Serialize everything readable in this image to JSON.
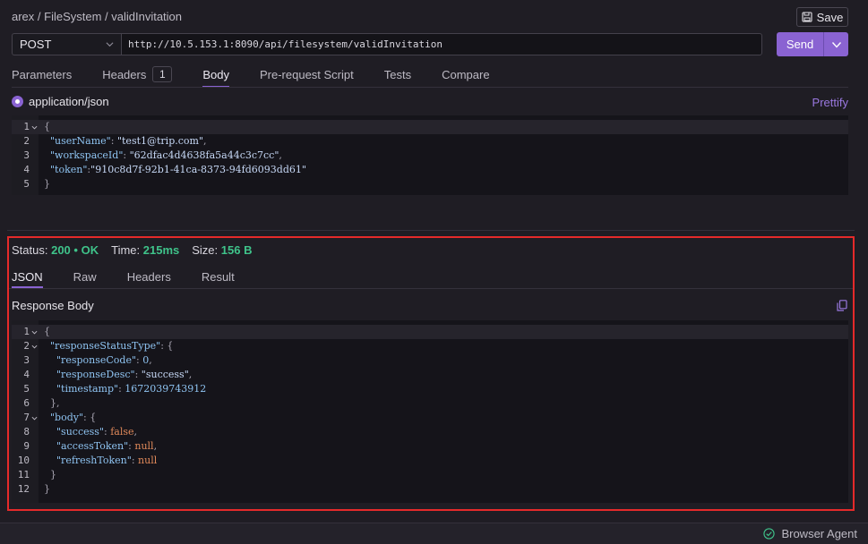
{
  "breadcrumb": "arex / FileSystem / validInvitation",
  "toolbar": {
    "save_label": "Save"
  },
  "request": {
    "method": "POST",
    "url": "http://10.5.153.1:8090/api/filesystem/validInvitation",
    "send_label": "Send"
  },
  "tabs": {
    "parameters": "Parameters",
    "headers": "Headers",
    "headers_count": "1",
    "body": "Body",
    "prerequest": "Pre-request Script",
    "tests": "Tests",
    "compare": "Compare"
  },
  "body": {
    "content_type": "application/json",
    "prettify_label": "Prettify",
    "line_numbers": [
      "1",
      "2",
      "3",
      "4",
      "5"
    ],
    "lines": {
      "l1": "{",
      "l2_key": "\"userName\"",
      "l2_val": "\"test1@trip.com\"",
      "l3_key": "\"workspaceId\"",
      "l3_val": "\"62dfac4d4638fa5a44c3c7cc\"",
      "l4_key": "\"token\"",
      "l4_val": "\"910c8d7f-92b1-41ca-8373-94fd6093dd61\"",
      "l5": "}"
    }
  },
  "response": {
    "status_label": "Status:",
    "status_code": "200",
    "status_dot": "•",
    "status_text": "OK",
    "time_label": "Time:",
    "time_value": "215ms",
    "size_label": "Size:",
    "size_value": "156 B",
    "tabs": {
      "json": "JSON",
      "raw": "Raw",
      "headers": "Headers",
      "result": "Result"
    },
    "title": "Response Body",
    "line_numbers": [
      "1",
      "2",
      "3",
      "4",
      "5",
      "6",
      "7",
      "8",
      "9",
      "10",
      "11",
      "12"
    ],
    "lines": {
      "l1": "{",
      "l2_key": "\"responseStatusType\"",
      "l2_tail": ": {",
      "l3_key": "\"responseCode\"",
      "l3_val": "0",
      "l4_key": "\"responseDesc\"",
      "l4_val": "\"success\"",
      "l5_key": "\"timestamp\"",
      "l5_val": "1672039743912",
      "l6": "},",
      "l7_key": "\"body\"",
      "l7_tail": ": {",
      "l8_key": "\"success\"",
      "l8_val": "false",
      "l9_key": "\"accessToken\"",
      "l9_val": "null",
      "l10_key": "\"refreshToken\"",
      "l10_val": "null",
      "l11": "}",
      "l12": "}"
    }
  },
  "footer": {
    "agent_label": "Browser Agent"
  },
  "icons": {
    "save": "save-icon",
    "method_dropdown": "chevron-down-icon",
    "send_dropdown": "chevron-down-icon",
    "copy": "copy-icon",
    "agent_status": "check-circle-icon",
    "fold": "fold-chevron-icon"
  },
  "colors": {
    "accent": "#8a63d2",
    "success": "#3fc38a",
    "highlight_border": "#e52a2a"
  }
}
